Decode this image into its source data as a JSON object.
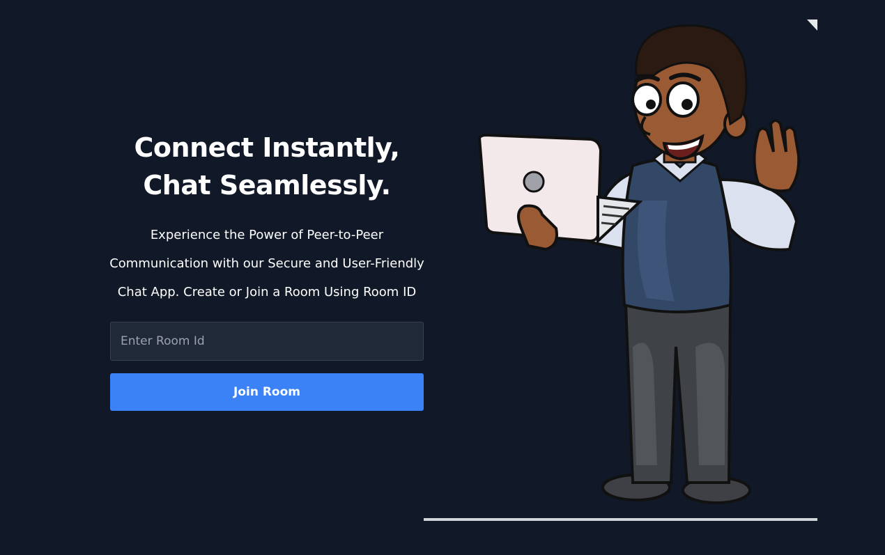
{
  "hero": {
    "headline_line1": "Connect Instantly,",
    "headline_line2": "Chat Seamlessly.",
    "description_line1": "Experience the Power of Peer-to-Peer",
    "description_line2": "Communication with our Secure and User-Friendly",
    "description_line3": "Chat App. Create or Join a Room Using Room ID"
  },
  "form": {
    "room_id_placeholder": "Enter Room Id",
    "room_id_value": "",
    "join_button_label": "Join Room"
  },
  "illustration": {
    "icon": "cartoon-man-waving-with-laptop"
  },
  "colors": {
    "background": "#111827",
    "input_background": "#1f2937",
    "accent": "#3b82f6",
    "text": "#ffffff",
    "placeholder": "#9ca3af"
  }
}
